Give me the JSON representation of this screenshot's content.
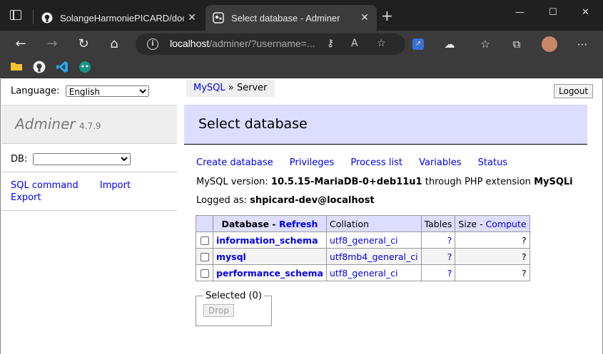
{
  "browser": {
    "tabs": [
      {
        "title": "SolangeHarmoniePICARD/doc_w"
      },
      {
        "title": "Select database - Adminer"
      }
    ],
    "address": {
      "host": "localhost",
      "path": "/adminer/?username=..."
    }
  },
  "lang": {
    "label": "Language:",
    "selected": "English"
  },
  "brand": {
    "name": "Adminer",
    "version": "4.7.9"
  },
  "db": {
    "label": "DB:"
  },
  "side_links": {
    "sql": "SQL command",
    "import": "Import",
    "export": "Export"
  },
  "breadcrumb": {
    "driver": "MySQL",
    "sep": "»",
    "current": "Server"
  },
  "logout": "Logout",
  "heading": "Select database",
  "actions": [
    "Create database",
    "Privileges",
    "Process list",
    "Variables",
    "Status"
  ],
  "version_line": {
    "prefix": "MySQL version:",
    "version": "10.5.15-MariaDB-0+deb11u1",
    "mid": "through PHP extension",
    "ext": "MySQLi"
  },
  "logged_line": {
    "prefix": "Logged as:",
    "user": "shpicard-dev@localhost"
  },
  "table": {
    "headers": {
      "database": "Database",
      "refresh": "Refresh",
      "collation": "Collation",
      "tables": "Tables",
      "size": "Size",
      "compute": "Compute"
    },
    "rows": [
      {
        "name": "information_schema",
        "collation": "utf8_general_ci",
        "tables": "?",
        "size": "?"
      },
      {
        "name": "mysql",
        "collation": "utf8mb4_general_ci",
        "tables": "?",
        "size": "?"
      },
      {
        "name": "performance_schema",
        "collation": "utf8_general_ci",
        "tables": "?",
        "size": "?"
      }
    ]
  },
  "selected": {
    "legend": "Selected (0)",
    "drop": "Drop"
  }
}
